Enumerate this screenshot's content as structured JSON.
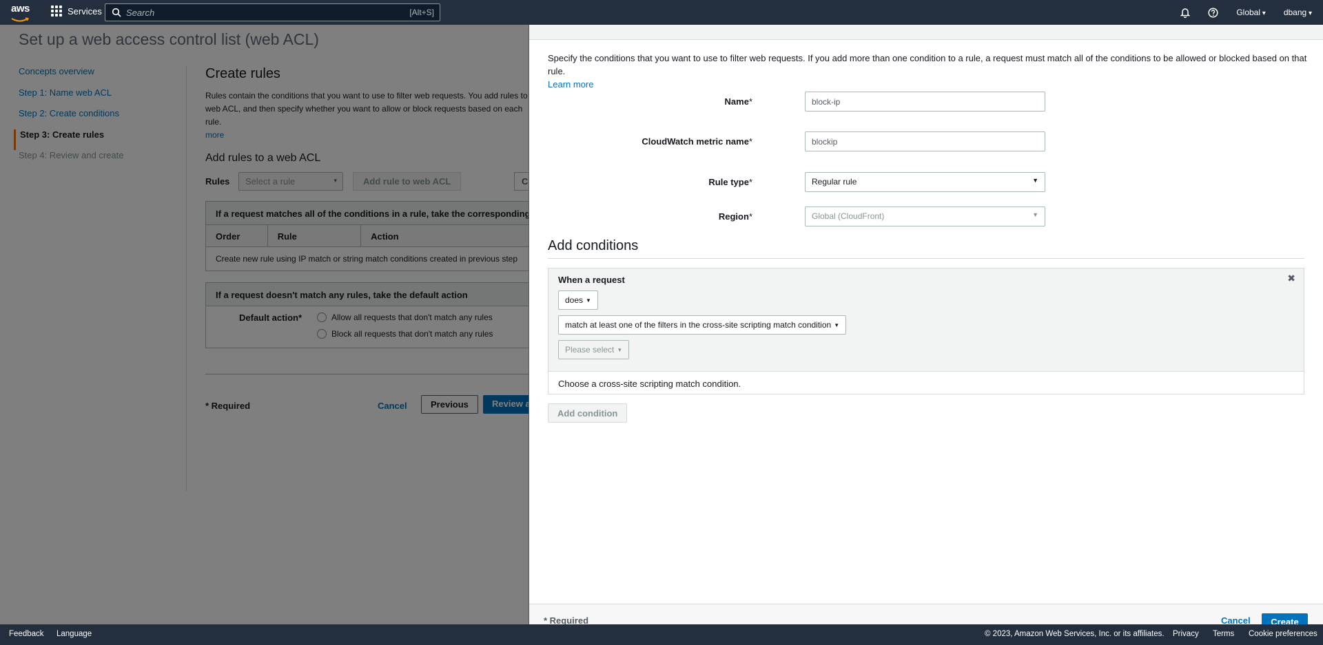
{
  "topnav": {
    "logo": "aws",
    "services_label": "Services",
    "search_placeholder": "Search",
    "search_shortcut": "[Alt+S]",
    "region": "Global",
    "user": "dbang"
  },
  "page": {
    "title": "Set up a web access control list (web ACL)"
  },
  "sidenav": {
    "items": [
      {
        "label": "Concepts overview"
      },
      {
        "label": "Step 1: Name web ACL"
      },
      {
        "label": "Step 2: Create conditions"
      },
      {
        "label": "Step 3: Create rules"
      },
      {
        "label": "Step 4: Review and create"
      }
    ]
  },
  "main": {
    "heading": "Create rules",
    "desc_line": "Rules contain the conditions that you want to use to filter web requests. You add rules to a web ACL, and then specify whether you want to allow or block requests based on each rule.",
    "more_link": "more",
    "subheading": "Add rules to a web ACL",
    "rules_label": "Rules",
    "select_rule_placeholder": "Select a rule",
    "add_rule_button": "Add rule to web ACL",
    "c_button": "C",
    "match_all_heading": "If a request matches all of the conditions in a rule, take the corresponding action",
    "columns": [
      "Order",
      "Rule",
      "Action"
    ],
    "empty_row": "Create new rule using IP match or string match conditions created in previous step",
    "default_heading": "If a request doesn't match any rules, take the default action",
    "default_action_label": "Default action*",
    "allow_option": "Allow all requests that don't match any rules",
    "block_option": "Block all requests that don't match any rules",
    "required": "* Required",
    "cancel": "Cancel",
    "previous": "Previous",
    "review": "Review and create"
  },
  "panel": {
    "intro": "Specify the conditions that you want to use to filter web requests. If you add more than one condition to a rule, a request must match all of the conditions to be allowed or blocked based on that rule.",
    "learn_more": "Learn more",
    "name_label": "Name",
    "name_value": "block-ip",
    "metric_label": "CloudWatch metric name",
    "metric_value": "blockip",
    "rule_type_label": "Rule type",
    "rule_type_value": "Regular rule",
    "region_label": "Region",
    "region_value": "Global (CloudFront)",
    "add_conditions_title": "Add conditions",
    "when_request": "When a request",
    "does": "does",
    "match_option": "match at least one of the filters in the cross-site scripting match condition",
    "please_select": "Please select",
    "choose_msg": "Choose a cross-site scripting match condition.",
    "add_condition_button": "Add condition",
    "required": "* Required",
    "cancel": "Cancel",
    "create": "Create"
  },
  "bottombar": {
    "feedback": "Feedback",
    "language": "Language",
    "copyright": "© 2023, Amazon Web Services, Inc. or its affiliates.",
    "privacy": "Privacy",
    "terms": "Terms",
    "cookie": "Cookie preferences"
  }
}
